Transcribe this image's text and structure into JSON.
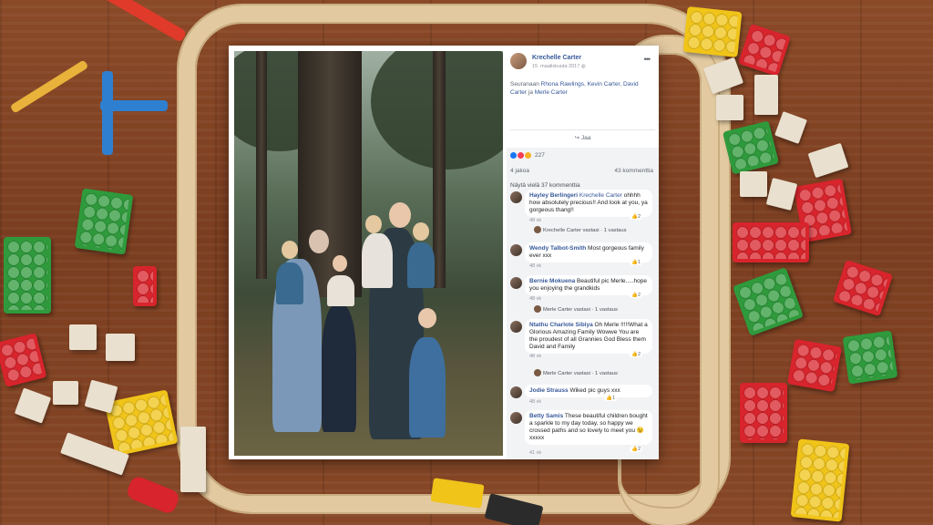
{
  "post": {
    "author": "Krechelle Carter",
    "date": "15. maaliskuuta 2017",
    "text_prefix": "Seuranaan",
    "tagged_1": "Rhona Rawlings",
    "tagged_2": "Kevin Carter",
    "tagged_3": "David Carter",
    "tagged_joiner": "ja",
    "tagged_4": "Merle Carter",
    "share_label": "Jaa",
    "reaction_count": "227",
    "shares": "4 jakoa",
    "comment_count": "43 kommenttia",
    "view_more": "Näytä vielä 37 kommenttia"
  },
  "comments": [
    {
      "author": "Hayley Berlingeri",
      "mention": "Krechelle Carter",
      "text": "ohhhh how absolutely precious!! And look at you, ya gorgeous thang!!",
      "time": "48 vk",
      "likes": "2",
      "reply": {
        "author": "Krechelle Carter",
        "label": "vastasi · 1 vastaus"
      }
    },
    {
      "author": "Wendy Talbot-Smith",
      "mention": "",
      "text": "Most gorgeous family ever xxx",
      "time": "48 vk",
      "likes": "1"
    },
    {
      "author": "Bernie Mokuena",
      "mention": "",
      "text": "Beautiful pic Merle.....hope you enjoying the grandkids",
      "time": "48 vk",
      "likes": "2",
      "reply": {
        "author": "Merle Carter",
        "label": "vastasi · 1 vastaus"
      }
    },
    {
      "author": "Ntathu Charlote Sibiya",
      "mention": "",
      "text": "Oh Merle !!!!!What a Glorious Amazing Family Wowwe You are the proudest of all Grannies God Bless them David and Family",
      "time": "48 vk",
      "likes": "2",
      "reply": {
        "author": "Merle Carter",
        "label": "vastasi · 1 vastaus"
      }
    },
    {
      "author": "Jodie Strauss",
      "mention": "",
      "text": "Wiked pic guys xxx",
      "time": "48 vk",
      "likes": "1"
    },
    {
      "author": "Betty Samis",
      "mention": "",
      "text": "These beautiful children bought a sparkle to my day today, so happy we crossed paths and so lovely to meet you 😉 xxxxx",
      "time": "41 vk",
      "likes": "2"
    }
  ],
  "icons": {
    "more": "more-options-icon",
    "share": "share-icon",
    "like": "like-icon",
    "love": "love-icon",
    "wow": "wow-icon"
  },
  "colors": {
    "link": "#365899",
    "like": "#1877f2",
    "love": "#f33e58",
    "wow": "#f7b125"
  }
}
